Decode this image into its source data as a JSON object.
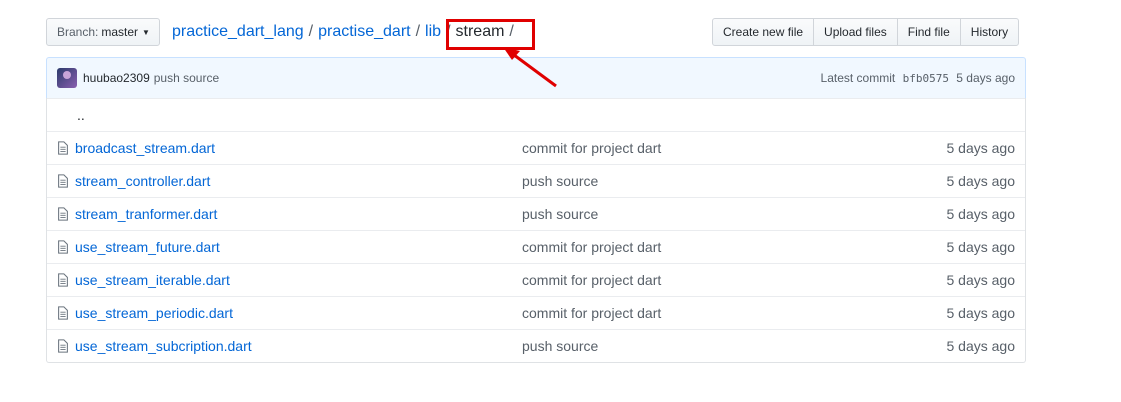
{
  "branch": {
    "label": "Branch:",
    "name": "master"
  },
  "breadcrumb": {
    "repo": "practice_dart_lang",
    "path1": "practise_dart",
    "path2": "lib",
    "current": "stream",
    "separator": "/"
  },
  "actions": {
    "create": "Create new file",
    "upload": "Upload files",
    "find": "Find file",
    "history": "History"
  },
  "commit": {
    "author": "huubao2309",
    "message": "push source",
    "prefix": "Latest commit",
    "sha": "bfb0575",
    "age": "5 days ago"
  },
  "parent_dir": "..",
  "files": [
    {
      "name": "broadcast_stream.dart",
      "message": "commit for project dart",
      "age": "5 days ago"
    },
    {
      "name": "stream_controller.dart",
      "message": "push source",
      "age": "5 days ago"
    },
    {
      "name": "stream_tranformer.dart",
      "message": "push source",
      "age": "5 days ago"
    },
    {
      "name": "use_stream_future.dart",
      "message": "commit for project dart",
      "age": "5 days ago"
    },
    {
      "name": "use_stream_iterable.dart",
      "message": "commit for project dart",
      "age": "5 days ago"
    },
    {
      "name": "use_stream_periodic.dart",
      "message": "commit for project dart",
      "age": "5 days ago"
    },
    {
      "name": "use_stream_subcription.dart",
      "message": "push source",
      "age": "5 days ago"
    }
  ],
  "colors": {
    "link": "#0366d6",
    "annotation": "#e00000",
    "commit_bar": "#f1f8ff"
  }
}
